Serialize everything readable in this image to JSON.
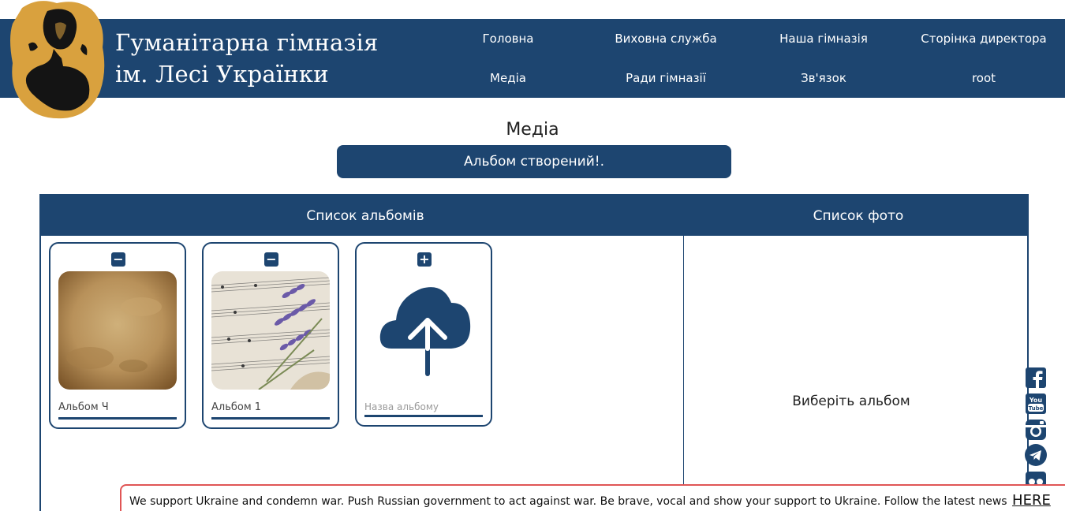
{
  "header": {
    "title_line1": "Гуманітарна гімназія",
    "title_line2": "ім. Лесі Українки",
    "brand_color": "#1d4570",
    "logo_accent": "#d9a13e"
  },
  "nav": {
    "items": [
      {
        "label": "Головна"
      },
      {
        "label": "Виховна служба"
      },
      {
        "label": "Наша гімназія"
      },
      {
        "label": "Сторінка директора"
      },
      {
        "label": "Медіа"
      },
      {
        "label": "Ради гімназії"
      },
      {
        "label": "Зв'язок"
      },
      {
        "label": "root"
      }
    ]
  },
  "page": {
    "heading": "Медіа",
    "alert": "Альбом створений!."
  },
  "panel": {
    "albums_header": "Список альбомів",
    "photos_header": "Список фото",
    "photos_empty": "Виберіть альбом",
    "albums": [
      {
        "label": "Альбом Ч",
        "action_icon": "minus-icon"
      },
      {
        "label": "Альбом 1",
        "action_icon": "minus-icon"
      }
    ],
    "new_album": {
      "action_icon": "plus-icon",
      "upload_icon": "cloud-upload-icon",
      "placeholder": "Назва альбому"
    }
  },
  "social_icons": [
    "facebook-icon",
    "youtube-icon",
    "instagram-icon",
    "telegram-icon",
    "more-icon"
  ],
  "banner": {
    "text": "We support Ukraine and condemn war. Push Russian government to act against war. Be brave, vocal and show your support to Ukraine. Follow the latest news",
    "link": "HERE"
  }
}
